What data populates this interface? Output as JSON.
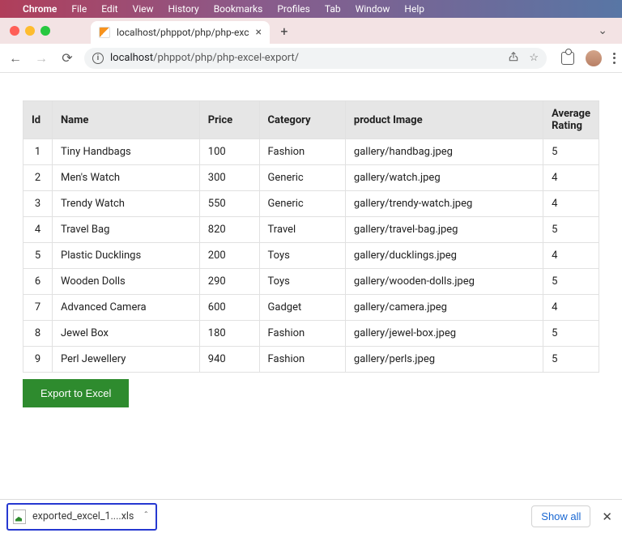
{
  "menubar": {
    "items": [
      "Chrome",
      "File",
      "Edit",
      "View",
      "History",
      "Bookmarks",
      "Profiles",
      "Tab",
      "Window",
      "Help"
    ]
  },
  "tab": {
    "title": "localhost/phppot/php/php-exc"
  },
  "omnibox": {
    "host": "localhost",
    "path": "/phppot/php/php-excel-export/"
  },
  "table": {
    "headers": [
      "Id",
      "Name",
      "Price",
      "Category",
      "product Image",
      "Average Rating"
    ],
    "rows": [
      {
        "id": "1",
        "name": "Tiny Handbags",
        "price": "100",
        "category": "Fashion",
        "image": "gallery/handbag.jpeg",
        "rating": "5"
      },
      {
        "id": "2",
        "name": "Men's Watch",
        "price": "300",
        "category": "Generic",
        "image": "gallery/watch.jpeg",
        "rating": "4"
      },
      {
        "id": "3",
        "name": "Trendy Watch",
        "price": "550",
        "category": "Generic",
        "image": "gallery/trendy-watch.jpeg",
        "rating": "4"
      },
      {
        "id": "4",
        "name": "Travel Bag",
        "price": "820",
        "category": "Travel",
        "image": "gallery/travel-bag.jpeg",
        "rating": "5"
      },
      {
        "id": "5",
        "name": "Plastic Ducklings",
        "price": "200",
        "category": "Toys",
        "image": "gallery/ducklings.jpeg",
        "rating": "4"
      },
      {
        "id": "6",
        "name": "Wooden Dolls",
        "price": "290",
        "category": "Toys",
        "image": "gallery/wooden-dolls.jpeg",
        "rating": "5"
      },
      {
        "id": "7",
        "name": "Advanced Camera",
        "price": "600",
        "category": "Gadget",
        "image": "gallery/camera.jpeg",
        "rating": "4"
      },
      {
        "id": "8",
        "name": "Jewel Box",
        "price": "180",
        "category": "Fashion",
        "image": "gallery/jewel-box.jpeg",
        "rating": "5"
      },
      {
        "id": "9",
        "name": "Perl Jewellery",
        "price": "940",
        "category": "Fashion",
        "image": "gallery/perls.jpeg",
        "rating": "5"
      }
    ]
  },
  "buttons": {
    "export": "Export to Excel",
    "show_all": "Show all"
  },
  "download": {
    "filename": "exported_excel_1....xls"
  }
}
